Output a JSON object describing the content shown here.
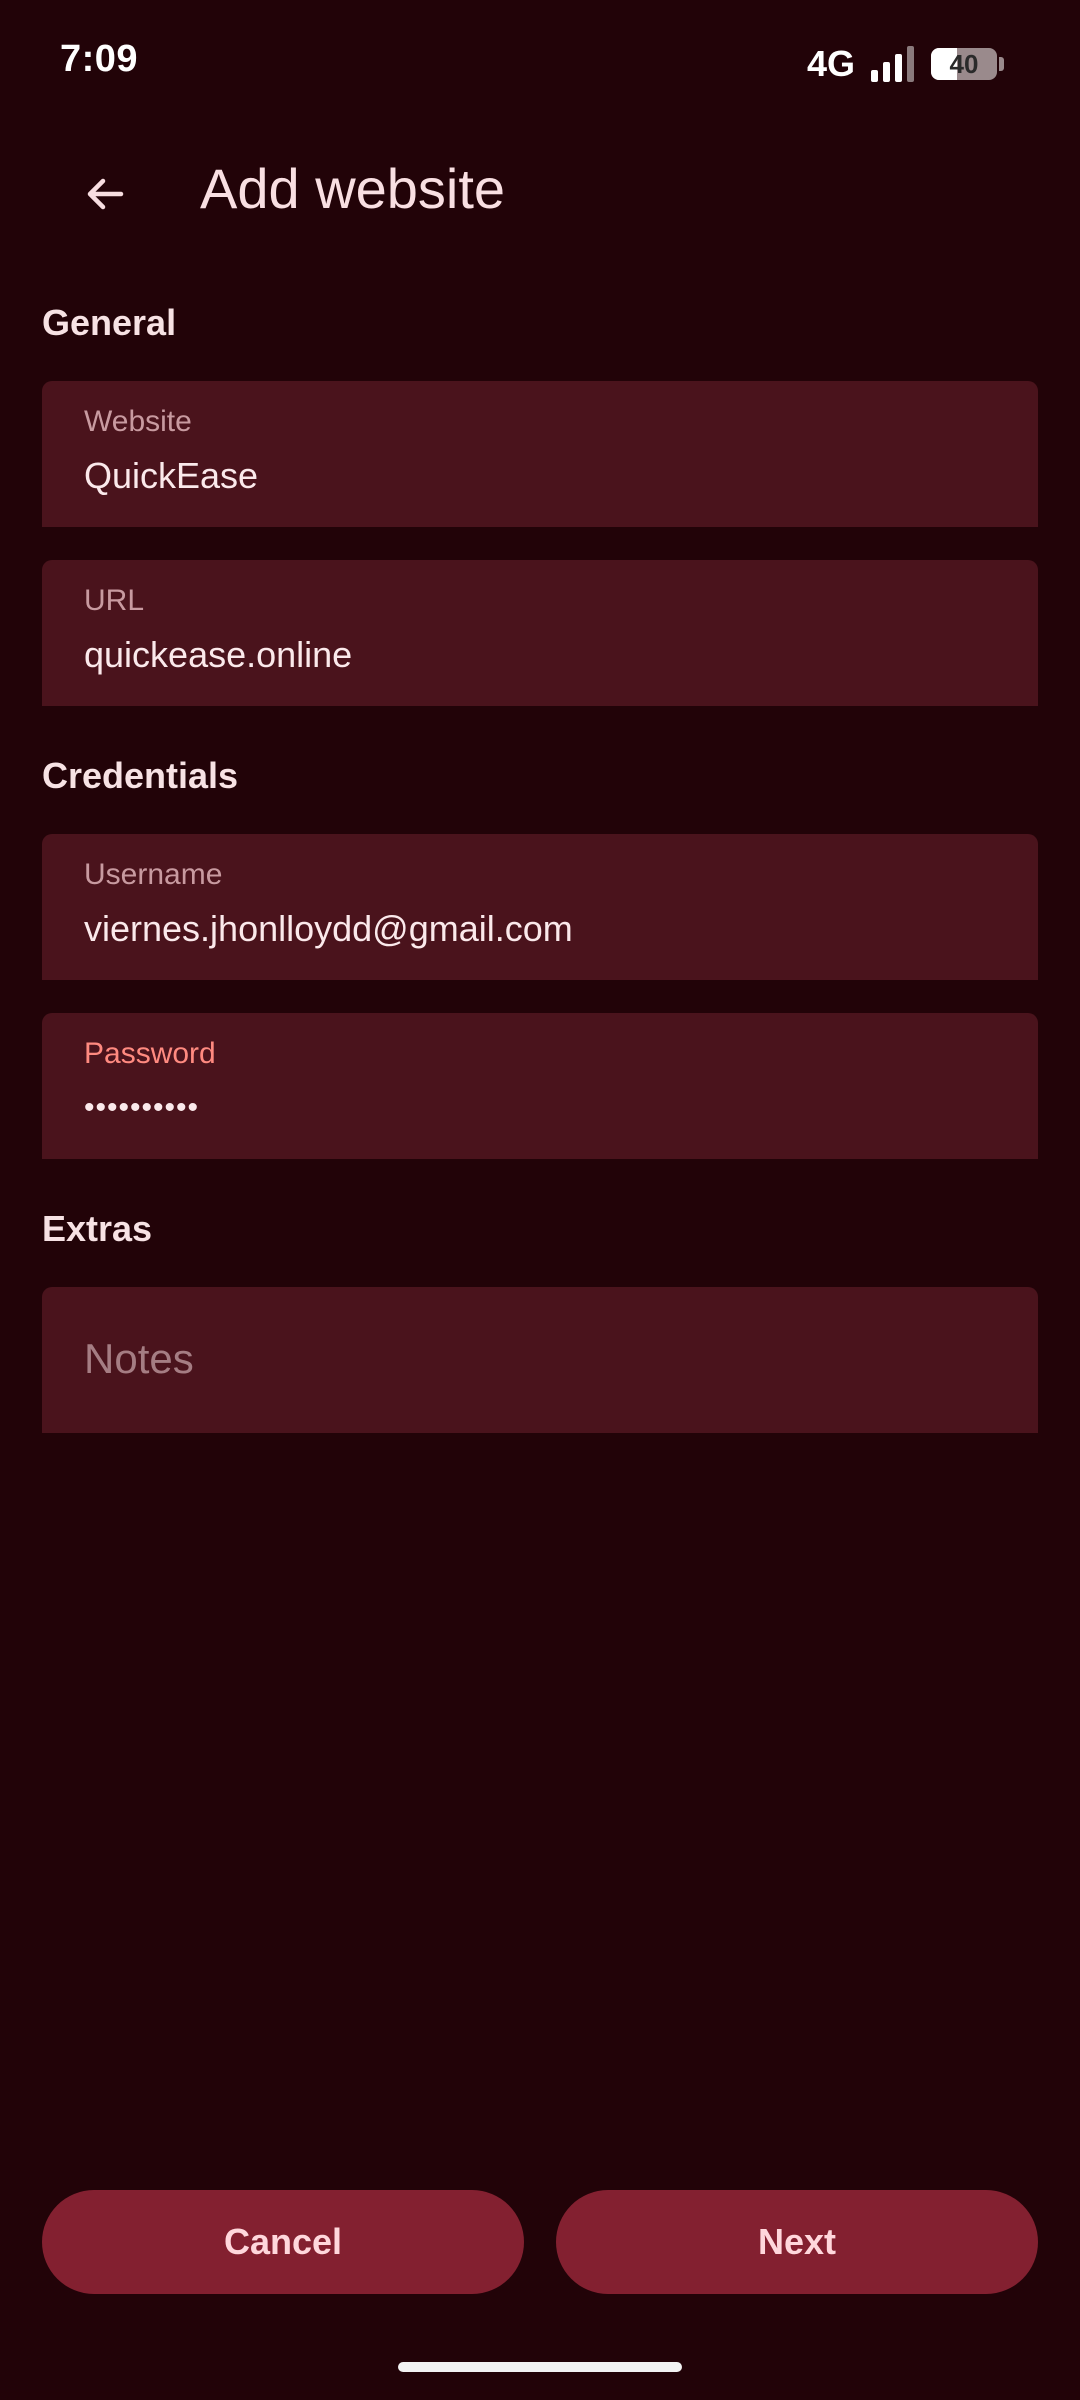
{
  "status_bar": {
    "time": "7:09",
    "network": "4G",
    "battery": "40",
    "battery_level": 0.4
  },
  "app_bar": {
    "back_icon": "arrow-back-icon",
    "title": "Add website"
  },
  "sections": {
    "general": "General",
    "credentials": "Credentials",
    "extras": "Extras"
  },
  "fields": {
    "website": {
      "label": "Website",
      "value": "QuickEase"
    },
    "url": {
      "label": "URL",
      "value": "quickease.online"
    },
    "username": {
      "label": "Username",
      "value": "viernes.jhonlloydd@gmail.com"
    },
    "password": {
      "label": "Password",
      "value": "••••••••••"
    },
    "notes": {
      "placeholder": "Notes"
    }
  },
  "buttons": {
    "cancel": "Cancel",
    "next": "Next"
  },
  "colors": {
    "background": "#220308",
    "field_background": "#4a131c",
    "button_background": "#832030",
    "focused_label": "#ff8a80"
  }
}
